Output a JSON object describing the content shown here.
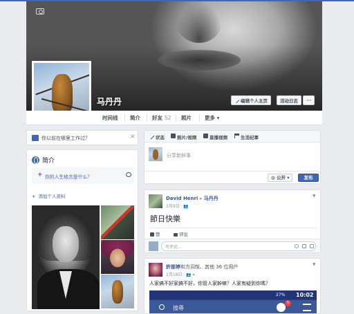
{
  "profile": {
    "name": "马丹丹",
    "edit_button": "编辑个人主页",
    "activity_log_button": "活动日志",
    "more_button": "···"
  },
  "tabs": [
    {
      "label": "时间线"
    },
    {
      "label": "简介"
    },
    {
      "label": "好友",
      "count": "52"
    },
    {
      "label": "照片"
    },
    {
      "label": "更多",
      "suffix": "▾"
    }
  ],
  "work_prompt": {
    "text": "你以前在哪里工作过？",
    "close": "×"
  },
  "intro": {
    "title": "简介",
    "motto_prompt": "你的人生格言是什么？",
    "add_info": "添加个人资料"
  },
  "composer": {
    "tabs": [
      "状态",
      "照片/视频",
      "直播视频",
      "生活纪事"
    ],
    "placeholder": "分享新鲜事",
    "privacy": "公开",
    "privacy_caret": "▾",
    "publish": "发布"
  },
  "posts": [
    {
      "author": "David Henri",
      "arrow": "▸",
      "target": "马丹丹",
      "date": "3月9日",
      "text": "節日快樂",
      "like": "赞",
      "comment": "评论",
      "comment_placeholder": "写评论..."
    },
    {
      "author": "許部婷",
      "with": "和方羽悅、其他 36 位用户",
      "date": "2月18日",
      "text": "人家搞不好家搞不好，你管人家幹嘛？人家有疑到你嗎？",
      "screenshot": {
        "time": "10:02",
        "battery": "27%",
        "search": "搜尋",
        "badge": "5"
      }
    }
  ],
  "colors": {
    "brand": "#4267b2",
    "link": "#365899",
    "badge": "#fa3e3e"
  }
}
